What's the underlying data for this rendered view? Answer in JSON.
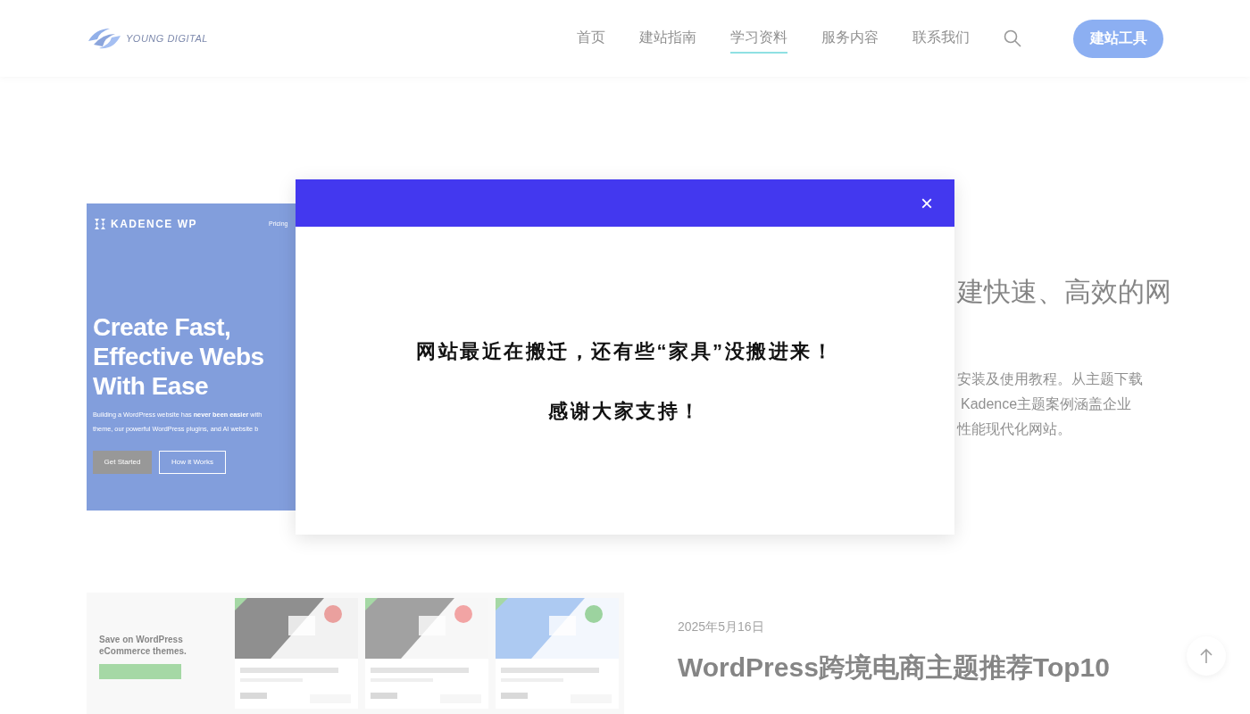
{
  "header": {
    "logo_text": "YOUNG DIGITAL",
    "nav": [
      {
        "label": "首页",
        "selected": false
      },
      {
        "label": "建站指南",
        "selected": false
      },
      {
        "label": "学习资料",
        "selected": true
      },
      {
        "label": "服务内容",
        "selected": false
      },
      {
        "label": "联系我们",
        "selected": false
      }
    ],
    "cta": "建站工具"
  },
  "posts": [
    {
      "kind": "kadence",
      "image": {
        "brand": "KADENCE WP",
        "menu": "Pricing",
        "headline": [
          "Create Fast,",
          "Effective Webs",
          "With Ease"
        ],
        "text": [
          "Building a WordPress website has **never been easier** with",
          "theme, our powerful WordPress plugins, and AI website b"
        ],
        "buttons": [
          "Get Started",
          "How it Works"
        ]
      },
      "title": "建快速、高效的网",
      "excerpt": [
        "安装及使用教程。从主题下载",
        "Kadence主题案例涵盖企业",
        "性能现代化网站。"
      ]
    },
    {
      "kind": "shop",
      "image": {
        "heading": "Save on WordPress eCommerce themes."
      },
      "date": "2025年5月16日",
      "title": "WordPress跨境电商主题推荐Top10"
    }
  ],
  "modal": {
    "close": "×",
    "messages": [
      "网站最近在搬迁，还有些“家具”没搬进来！",
      "感谢大家支持！"
    ]
  }
}
